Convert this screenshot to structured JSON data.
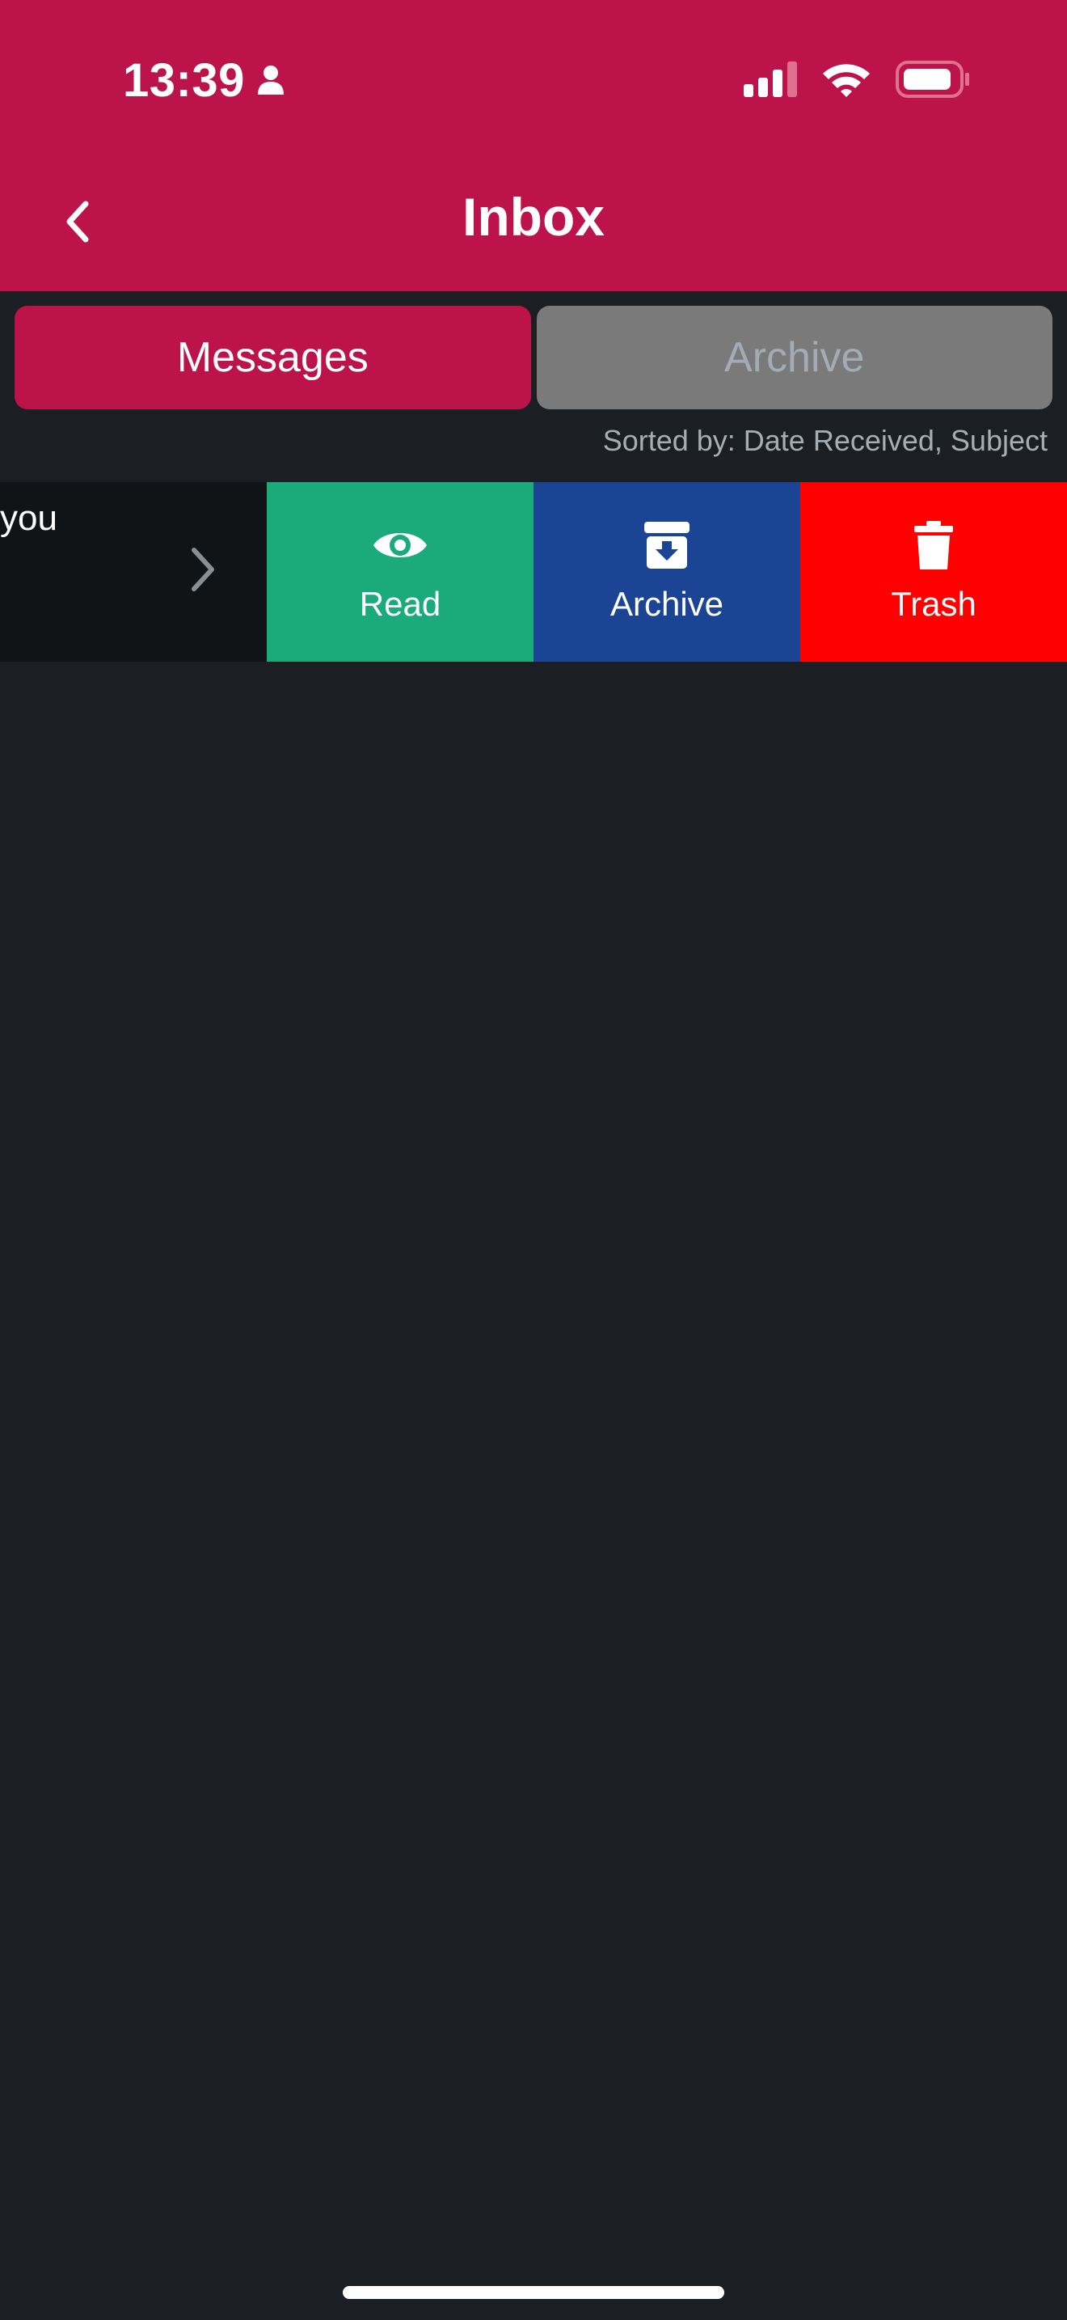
{
  "status_bar": {
    "time": "13:39",
    "icons": [
      "person-icon",
      "cellular-signal-icon",
      "wifi-icon",
      "battery-icon"
    ]
  },
  "nav": {
    "title": "Inbox",
    "back_icon": "chevron-left-icon"
  },
  "tabs": [
    {
      "label": "Messages",
      "selected": true
    },
    {
      "label": "Archive",
      "selected": false
    }
  ],
  "sort": {
    "label": "Sorted by: Date Received, Subject"
  },
  "message_row": {
    "snippet": "you",
    "chevron_icon": "chevron-right-icon",
    "actions": [
      {
        "label": "Read",
        "icon": "eye-icon",
        "color": "#1bab7a"
      },
      {
        "label": "Archive",
        "icon": "archive-box-icon",
        "color": "#1c4495"
      },
      {
        "label": "Trash",
        "icon": "trash-icon",
        "color": "#ff0000"
      }
    ]
  },
  "colors": {
    "brand": "#bc134a",
    "background": "#1b1f23",
    "inactive_tab": "#7a7a7a"
  }
}
